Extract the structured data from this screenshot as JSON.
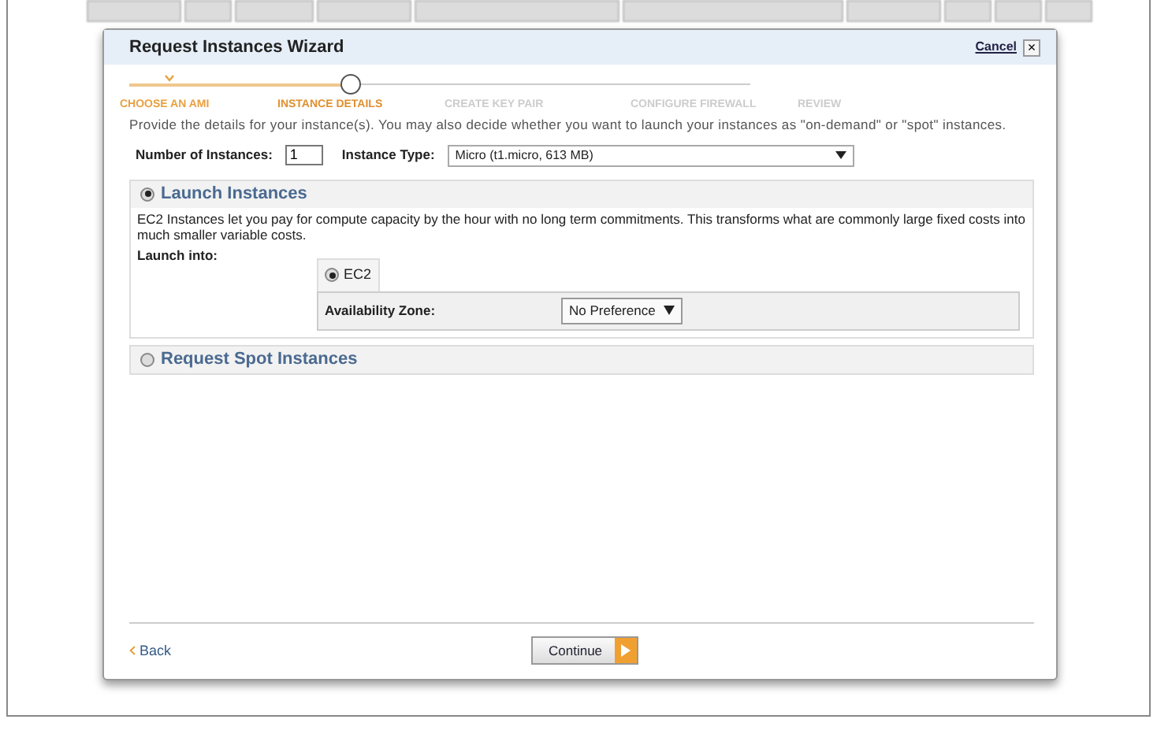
{
  "dialog": {
    "title": "Request Instances Wizard",
    "cancel": "Cancel",
    "close": "×"
  },
  "steps": [
    {
      "label": "CHOOSE AN AMI",
      "completed": true,
      "selected": false
    },
    {
      "label": "INSTANCE DETAILS",
      "completed": false,
      "selected": true
    },
    {
      "label": "CREATE KEY PAIR",
      "completed": false,
      "selected": false
    },
    {
      "label": "CONFIGURE FIREWALL",
      "completed": false,
      "selected": false
    },
    {
      "label": "REVIEW",
      "completed": false,
      "selected": false
    }
  ],
  "intro": "Provide the details for your instance(s). You may also decide whether you want to launch your instances as \"on-demand\" or \"spot\" instances.",
  "fields": {
    "count_label": "Number of Instances:",
    "count_value": "1",
    "type_label": "Instance Type:",
    "type_value": "Micro (t1.micro, 613 MB)"
  },
  "sections": [
    {
      "title": "Launch Instances",
      "selected": true,
      "description": "EC2 Instances let you pay for compute capacity by the hour with no long term commitments. This transforms what are commonly large fixed costs into much smaller variable costs.",
      "launch_label": "Launch into:",
      "launch_option": {
        "label": "EC2",
        "selected": true
      },
      "zone_label": "Availability Zone:",
      "zone_value": "No Preference"
    },
    {
      "title": "Request Spot Instances",
      "selected": false
    }
  ],
  "footer": {
    "back": "Back",
    "continue": "Continue"
  }
}
